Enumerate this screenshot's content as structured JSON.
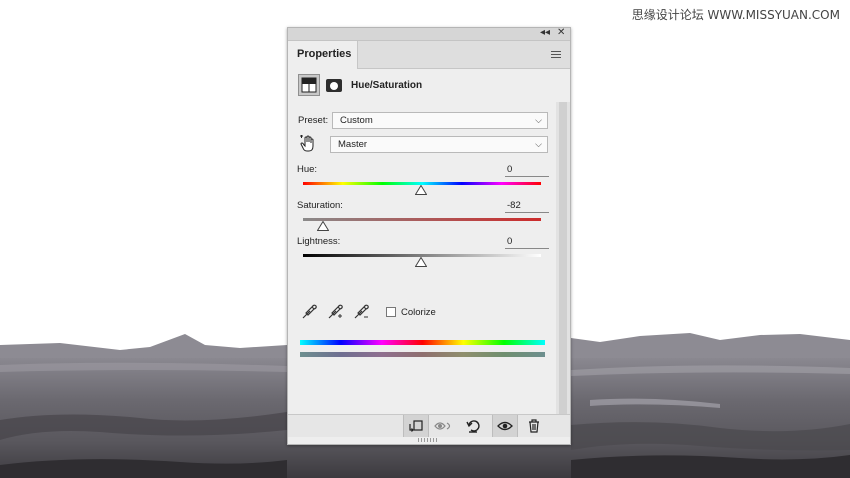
{
  "watermark": "思缘设计论坛 WWW.MISSYUAN.COM",
  "panel": {
    "tab_label": "Properties",
    "title": "Hue/Saturation",
    "icons": [
      "adjustment-layer-icon",
      "layer-mask-icon",
      "panel-menu-icon",
      "collapse-icon",
      "close-icon"
    ],
    "preset": {
      "label": "Preset:",
      "value": "Custom"
    },
    "channel": {
      "value": "Master",
      "icon": "targeted-adjustment-hand-icon"
    },
    "hue": {
      "label": "Hue:",
      "value": "0",
      "slider_fraction": 0.5
    },
    "saturation": {
      "label": "Saturation:",
      "value": "-82",
      "slider_fraction": 0.09
    },
    "lightness": {
      "label": "Lightness:",
      "value": "0",
      "slider_fraction": 0.5
    },
    "tools": [
      "eyedropper-icon",
      "eyedropper-plus-icon",
      "eyedropper-minus-icon"
    ],
    "colorize": {
      "label": "Colorize",
      "checked": false
    },
    "bottom_icons": [
      "clip-to-layer-icon",
      "view-previous-state-icon",
      "reset-icon",
      "visibility-eye-icon",
      "delete-icon"
    ]
  },
  "colors": {
    "panel_bg": "#eeeeee",
    "saturation_track": "#cc2b2b"
  }
}
